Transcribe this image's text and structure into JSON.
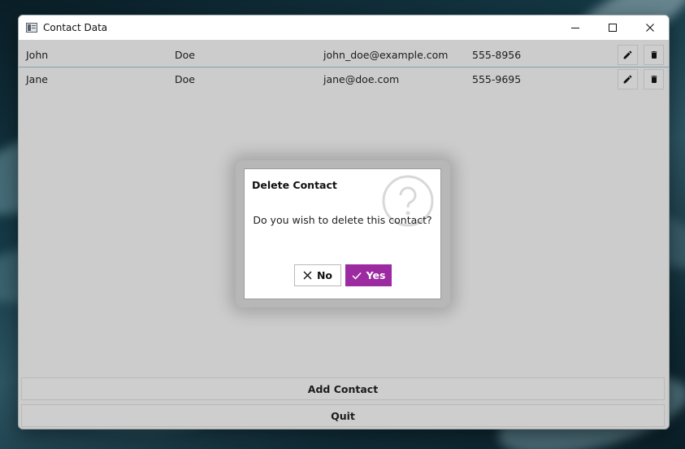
{
  "window": {
    "title": "Contact Data",
    "controls": [
      "minimize",
      "maximize",
      "close"
    ]
  },
  "contacts": [
    {
      "first": "John",
      "last": "Doe",
      "email": "john_doe@example.com",
      "phone": "555-8956"
    },
    {
      "first": "Jane",
      "last": "Doe",
      "email": "jane@doe.com",
      "phone": "555-9695"
    }
  ],
  "actions": {
    "add_label": "Add Contact",
    "quit_label": "Quit"
  },
  "dialog": {
    "title": "Delete Contact",
    "message": "Do you wish to delete this contact?",
    "no_label": "No",
    "yes_label": "Yes",
    "icon": "question-icon"
  },
  "colors": {
    "accent": "#9c2aa0",
    "window_bg": "#cccccc",
    "row_separator": "#7fa3a8"
  },
  "icons": {
    "edit": "pencil-icon",
    "delete": "trash-icon",
    "no": "x-icon",
    "yes": "check-icon"
  }
}
